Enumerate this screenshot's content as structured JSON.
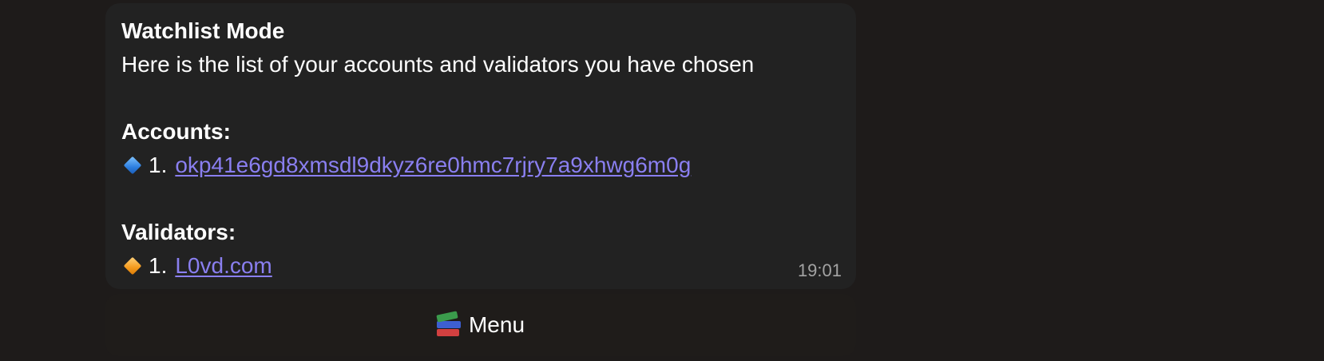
{
  "message": {
    "title": "Watchlist Mode",
    "intro": "Here is the list of your accounts and validators you have chosen",
    "accounts_heading": "Accounts:",
    "accounts": [
      {
        "number": "1.",
        "address": "okp41e6gd8xmsdl9dkyz6re0hmc7rjry7a9xhwg6m0g",
        "icon": "blue-diamond-icon"
      }
    ],
    "validators_heading": "Validators:",
    "validators": [
      {
        "number": "1.",
        "name": "L0vd.com",
        "icon": "orange-diamond-icon"
      }
    ],
    "time": "19:01"
  },
  "keyboard": {
    "menu_label": "Menu",
    "menu_icon": "books-icon"
  },
  "colors": {
    "background": "#1e1b1a",
    "bubble": "#222222",
    "link": "#8a7ff0",
    "timestamp": "#a3a3a3"
  }
}
